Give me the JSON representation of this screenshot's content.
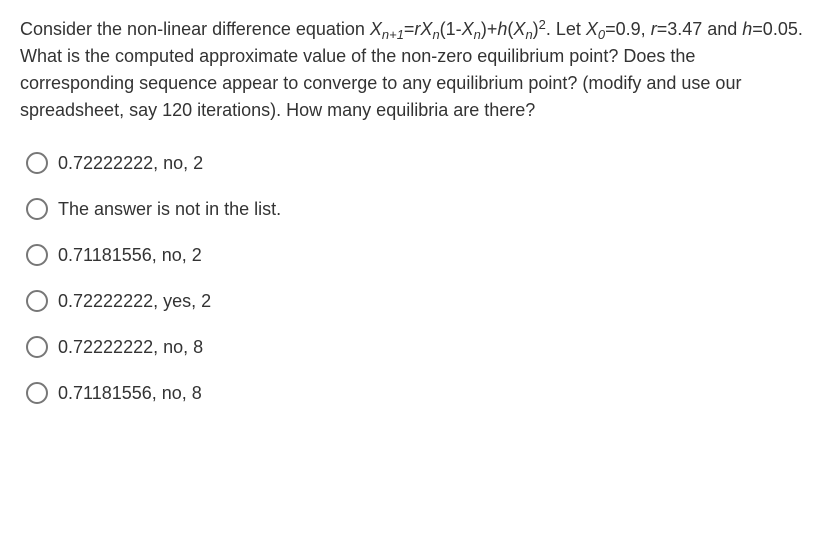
{
  "question": {
    "pre": "Consider the non-linear difference equation ",
    "eq_x": "X",
    "eq_sub_n1": "n+1",
    "eq_eq": "=",
    "eq_r": "r",
    "eq_x2": "X",
    "eq_sub_n": "n",
    "eq_p1": "(1-",
    "eq_x3": "X",
    "eq_sub_n2": "n",
    "eq_p2": ")+",
    "eq_h": "h",
    "eq_p3": "(",
    "eq_x4": "X",
    "eq_sub_n3": "n",
    "eq_p4": ")",
    "eq_sq": "2",
    "post1": ". Let ",
    "eq_x0": "X",
    "eq_sub0": "0",
    "post2": "=0.9, ",
    "eq_r2": "r",
    "post3": "=3.47 and ",
    "eq_h2": "h",
    "post4": "=0.05. What is the computed approximate value of the non-zero equilibrium point? Does the corresponding sequence appear to converge to any equilibrium point? (modify and use our spreadsheet, say 120 iterations). How many equilibria are there?"
  },
  "options": [
    {
      "label": "0.72222222, no, 2"
    },
    {
      "label": "The answer is not in the list."
    },
    {
      "label": "0.71181556, no, 2"
    },
    {
      "label": "0.72222222, yes, 2"
    },
    {
      "label": "0.72222222, no, 8"
    },
    {
      "label": "0.71181556, no, 8"
    }
  ]
}
